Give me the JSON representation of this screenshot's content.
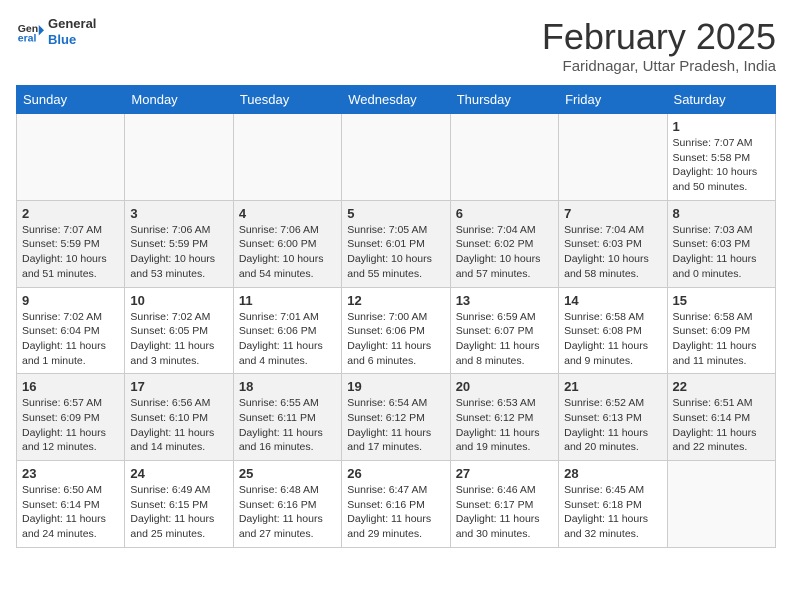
{
  "header": {
    "logo_general": "General",
    "logo_blue": "Blue",
    "month_year": "February 2025",
    "location": "Faridnagar, Uttar Pradesh, India"
  },
  "weekdays": [
    "Sunday",
    "Monday",
    "Tuesday",
    "Wednesday",
    "Thursday",
    "Friday",
    "Saturday"
  ],
  "weeks": [
    [
      {
        "day": "",
        "info": ""
      },
      {
        "day": "",
        "info": ""
      },
      {
        "day": "",
        "info": ""
      },
      {
        "day": "",
        "info": ""
      },
      {
        "day": "",
        "info": ""
      },
      {
        "day": "",
        "info": ""
      },
      {
        "day": "1",
        "info": "Sunrise: 7:07 AM\nSunset: 5:58 PM\nDaylight: 10 hours\nand 50 minutes."
      }
    ],
    [
      {
        "day": "2",
        "info": "Sunrise: 7:07 AM\nSunset: 5:59 PM\nDaylight: 10 hours\nand 51 minutes."
      },
      {
        "day": "3",
        "info": "Sunrise: 7:06 AM\nSunset: 5:59 PM\nDaylight: 10 hours\nand 53 minutes."
      },
      {
        "day": "4",
        "info": "Sunrise: 7:06 AM\nSunset: 6:00 PM\nDaylight: 10 hours\nand 54 minutes."
      },
      {
        "day": "5",
        "info": "Sunrise: 7:05 AM\nSunset: 6:01 PM\nDaylight: 10 hours\nand 55 minutes."
      },
      {
        "day": "6",
        "info": "Sunrise: 7:04 AM\nSunset: 6:02 PM\nDaylight: 10 hours\nand 57 minutes."
      },
      {
        "day": "7",
        "info": "Sunrise: 7:04 AM\nSunset: 6:03 PM\nDaylight: 10 hours\nand 58 minutes."
      },
      {
        "day": "8",
        "info": "Sunrise: 7:03 AM\nSunset: 6:03 PM\nDaylight: 11 hours\nand 0 minutes."
      }
    ],
    [
      {
        "day": "9",
        "info": "Sunrise: 7:02 AM\nSunset: 6:04 PM\nDaylight: 11 hours\nand 1 minute."
      },
      {
        "day": "10",
        "info": "Sunrise: 7:02 AM\nSunset: 6:05 PM\nDaylight: 11 hours\nand 3 minutes."
      },
      {
        "day": "11",
        "info": "Sunrise: 7:01 AM\nSunset: 6:06 PM\nDaylight: 11 hours\nand 4 minutes."
      },
      {
        "day": "12",
        "info": "Sunrise: 7:00 AM\nSunset: 6:06 PM\nDaylight: 11 hours\nand 6 minutes."
      },
      {
        "day": "13",
        "info": "Sunrise: 6:59 AM\nSunset: 6:07 PM\nDaylight: 11 hours\nand 8 minutes."
      },
      {
        "day": "14",
        "info": "Sunrise: 6:58 AM\nSunset: 6:08 PM\nDaylight: 11 hours\nand 9 minutes."
      },
      {
        "day": "15",
        "info": "Sunrise: 6:58 AM\nSunset: 6:09 PM\nDaylight: 11 hours\nand 11 minutes."
      }
    ],
    [
      {
        "day": "16",
        "info": "Sunrise: 6:57 AM\nSunset: 6:09 PM\nDaylight: 11 hours\nand 12 minutes."
      },
      {
        "day": "17",
        "info": "Sunrise: 6:56 AM\nSunset: 6:10 PM\nDaylight: 11 hours\nand 14 minutes."
      },
      {
        "day": "18",
        "info": "Sunrise: 6:55 AM\nSunset: 6:11 PM\nDaylight: 11 hours\nand 16 minutes."
      },
      {
        "day": "19",
        "info": "Sunrise: 6:54 AM\nSunset: 6:12 PM\nDaylight: 11 hours\nand 17 minutes."
      },
      {
        "day": "20",
        "info": "Sunrise: 6:53 AM\nSunset: 6:12 PM\nDaylight: 11 hours\nand 19 minutes."
      },
      {
        "day": "21",
        "info": "Sunrise: 6:52 AM\nSunset: 6:13 PM\nDaylight: 11 hours\nand 20 minutes."
      },
      {
        "day": "22",
        "info": "Sunrise: 6:51 AM\nSunset: 6:14 PM\nDaylight: 11 hours\nand 22 minutes."
      }
    ],
    [
      {
        "day": "23",
        "info": "Sunrise: 6:50 AM\nSunset: 6:14 PM\nDaylight: 11 hours\nand 24 minutes."
      },
      {
        "day": "24",
        "info": "Sunrise: 6:49 AM\nSunset: 6:15 PM\nDaylight: 11 hours\nand 25 minutes."
      },
      {
        "day": "25",
        "info": "Sunrise: 6:48 AM\nSunset: 6:16 PM\nDaylight: 11 hours\nand 27 minutes."
      },
      {
        "day": "26",
        "info": "Sunrise: 6:47 AM\nSunset: 6:16 PM\nDaylight: 11 hours\nand 29 minutes."
      },
      {
        "day": "27",
        "info": "Sunrise: 6:46 AM\nSunset: 6:17 PM\nDaylight: 11 hours\nand 30 minutes."
      },
      {
        "day": "28",
        "info": "Sunrise: 6:45 AM\nSunset: 6:18 PM\nDaylight: 11 hours\nand 32 minutes."
      },
      {
        "day": "",
        "info": ""
      }
    ]
  ]
}
